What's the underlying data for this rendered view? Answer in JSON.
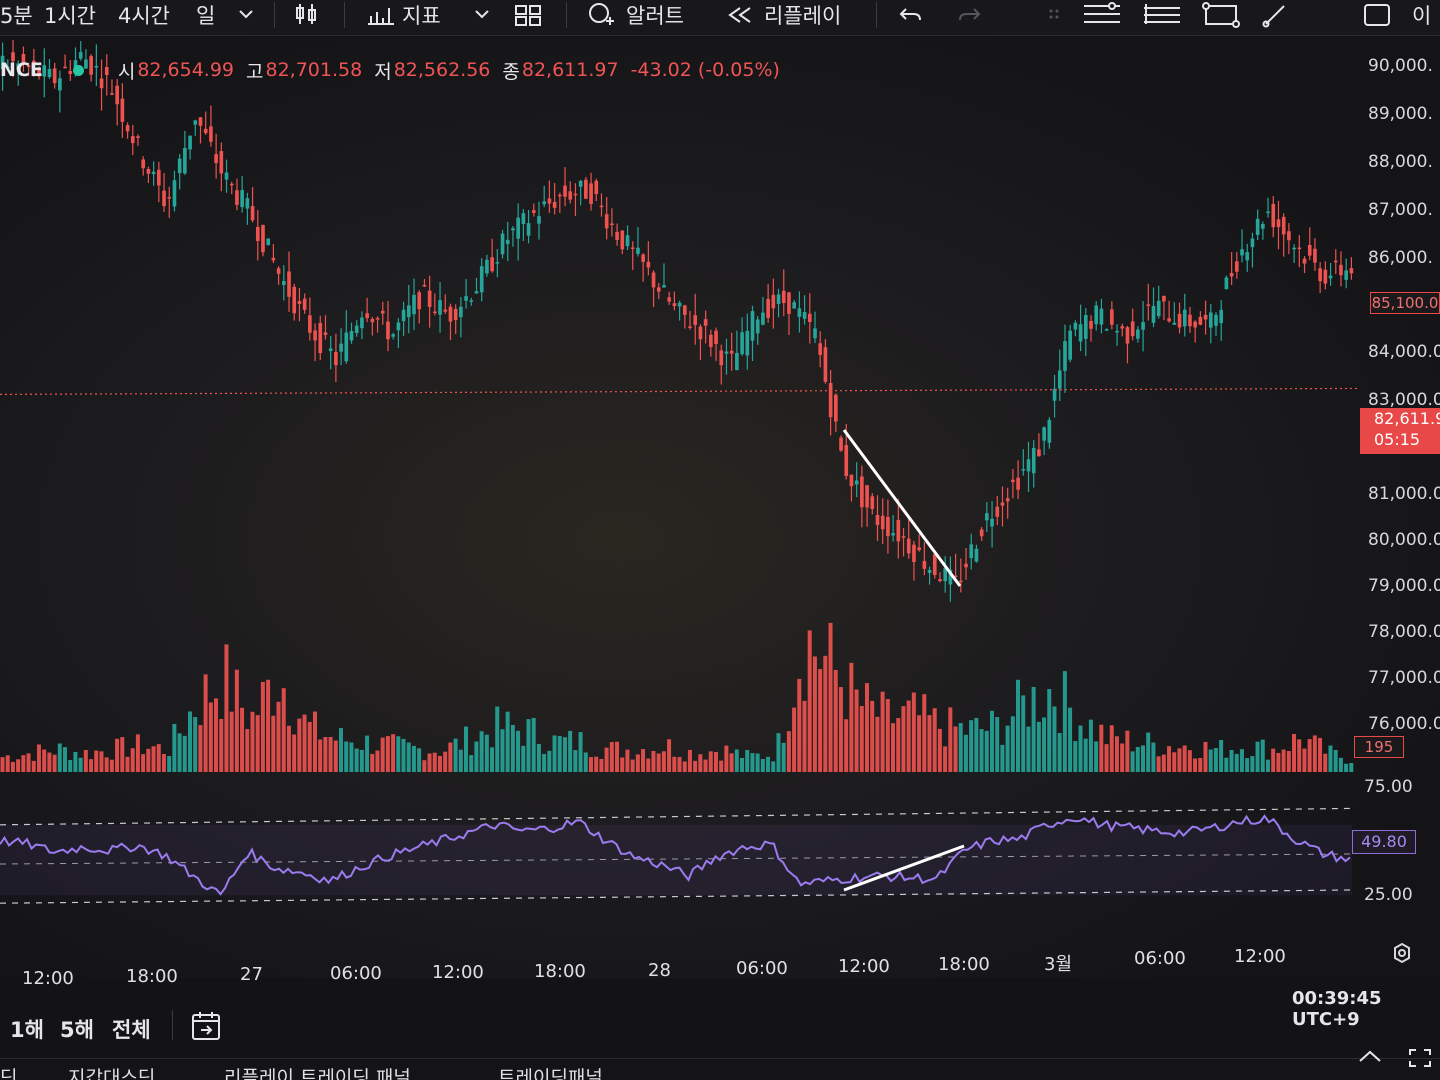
{
  "toolbar": {
    "items": [
      {
        "label": "5분"
      },
      {
        "label": "1시간"
      },
      {
        "label": "4시간"
      },
      {
        "label": "일"
      },
      {
        "label": "지표"
      },
      {
        "label": "알러트"
      },
      {
        "label": "리플레이"
      }
    ],
    "right_label": "이"
  },
  "legend": {
    "symbol": "NCE",
    "open_label": "시",
    "open": "82,654.99",
    "high_label": "고",
    "high": "82,701.58",
    "low_label": "저",
    "low": "82,562.56",
    "close_label": "종",
    "close": "82,611.97",
    "change": "-43.02 (-0.05%)"
  },
  "price_axis": [
    "90,000.",
    "89,000.",
    "88,000.",
    "87,000.",
    "86,000.",
    "84,000.0",
    "83,000.0",
    "81,000.0",
    "80,000.0",
    "79,000.0",
    "78,000.0",
    "77,000.0",
    "76,000.0"
  ],
  "price_badge": "85,100.0",
  "current_price": {
    "price": "82,611.9",
    "countdown": "05:15"
  },
  "volume_badge": "195",
  "rsi": {
    "value": "49.80",
    "upper": "75.00",
    "lower": "25.00"
  },
  "time_axis": [
    "12:00",
    "18:00",
    "27",
    "06:00",
    "12:00",
    "18:00",
    "28",
    "06:00",
    "12:00",
    "18:00",
    "3월",
    "06:00",
    "12:00"
  ],
  "clock": "00:39:45 UTC+9",
  "ranges": [
    "1해",
    "5해",
    "전체"
  ],
  "bottom_tabs": [
    "딘",
    "지갑대스딘",
    "리플레이 트레이딩 패널",
    "트레이딩패널"
  ],
  "colors": {
    "up": "#26a69a",
    "down": "#ef5350",
    "rsi": "#8f6fe0",
    "accent": "#e84848"
  },
  "chart_data": {
    "type": "candlestick",
    "price_series": [
      {
        "t": "26 09:00",
        "p": 89300
      },
      {
        "t": "26 12:00",
        "p": 89150
      },
      {
        "t": "26 15:00",
        "p": 88900
      },
      {
        "t": "26 17:00",
        "p": 89400
      },
      {
        "t": "26 19:00",
        "p": 88800
      },
      {
        "t": "26 21:00",
        "p": 87500
      },
      {
        "t": "26 22:00",
        "p": 86400
      },
      {
        "t": "26 23:00",
        "p": 88200
      },
      {
        "t": "27 00:00",
        "p": 87000
      },
      {
        "t": "27 01:00",
        "p": 86200
      },
      {
        "t": "27 02:00",
        "p": 85000
      },
      {
        "t": "27 03:00",
        "p": 84000
      },
      {
        "t": "27 04:00",
        "p": 83300
      },
      {
        "t": "27 05:00",
        "p": 84400
      },
      {
        "t": "27 06:00",
        "p": 83800
      },
      {
        "t": "27 08:00",
        "p": 84600
      },
      {
        "t": "27 10:00",
        "p": 84200
      },
      {
        "t": "27 12:00",
        "p": 84800
      },
      {
        "t": "27 14:00",
        "p": 85700
      },
      {
        "t": "27 16:00",
        "p": 86200
      },
      {
        "t": "27 18:00",
        "p": 86600
      },
      {
        "t": "27 20:00",
        "p": 86700
      },
      {
        "t": "27 22:00",
        "p": 85800
      },
      {
        "t": "28 00:00",
        "p": 85100
      },
      {
        "t": "28 02:00",
        "p": 84300
      },
      {
        "t": "28 04:00",
        "p": 83900
      },
      {
        "t": "28 05:00",
        "p": 83200
      },
      {
        "t": "28 07:00",
        "p": 84300
      },
      {
        "t": "28 09:00",
        "p": 84500
      },
      {
        "t": "28 10:00",
        "p": 83800
      },
      {
        "t": "28 11:00",
        "p": 81200
      },
      {
        "t": "28 12:00",
        "p": 80200
      },
      {
        "t": "28 14:00",
        "p": 79800
      },
      {
        "t": "28 16:00",
        "p": 79200
      },
      {
        "t": "28 18:00",
        "p": 78800
      },
      {
        "t": "28 19:00",
        "p": 80100
      },
      {
        "t": "28 21:00",
        "p": 80800
      },
      {
        "t": "28 23:00",
        "p": 81600
      },
      {
        "t": "01 00:00",
        "p": 83800
      },
      {
        "t": "01 02:00",
        "p": 84200
      },
      {
        "t": "01 04:00",
        "p": 83800
      },
      {
        "t": "01 06:00",
        "p": 84400
      },
      {
        "t": "01 08:00",
        "p": 84100
      },
      {
        "t": "01 10:00",
        "p": 84000
      },
      {
        "t": "01 12:00",
        "p": 85400
      },
      {
        "t": "01 14:00",
        "p": 86300
      },
      {
        "t": "01 16:00",
        "p": 85600
      },
      {
        "t": "01 18:00",
        "p": 85000
      },
      {
        "t": "01 19:00",
        "p": 85150
      }
    ],
    "current_price": 82611.97,
    "rsi_series": [
      62,
      60,
      55,
      58,
      56,
      59,
      53,
      40,
      28,
      55,
      45,
      42,
      37,
      45,
      52,
      57,
      62,
      67,
      72,
      68,
      70,
      74,
      62,
      52,
      47,
      40,
      52,
      58,
      60,
      35,
      37,
      39,
      40,
      39,
      38,
      56,
      62,
      63,
      72,
      77,
      72,
      70,
      68,
      67,
      70,
      74,
      76,
      63,
      54,
      50
    ],
    "volume_series": [
      4,
      5,
      6,
      5,
      6,
      7,
      6,
      18,
      25,
      14,
      26,
      12,
      9,
      8,
      7,
      6,
      6,
      9,
      12,
      11,
      8,
      8,
      6,
      6,
      7,
      5,
      6,
      4,
      5,
      36,
      28,
      18,
      14,
      15,
      12,
      11,
      12,
      18,
      22,
      14,
      9,
      8,
      7,
      7,
      6,
      7,
      6,
      9,
      5,
      3
    ],
    "ylim": [
      76000,
      90000
    ],
    "rsi_ylim": [
      0,
      100
    ],
    "grid": false
  }
}
